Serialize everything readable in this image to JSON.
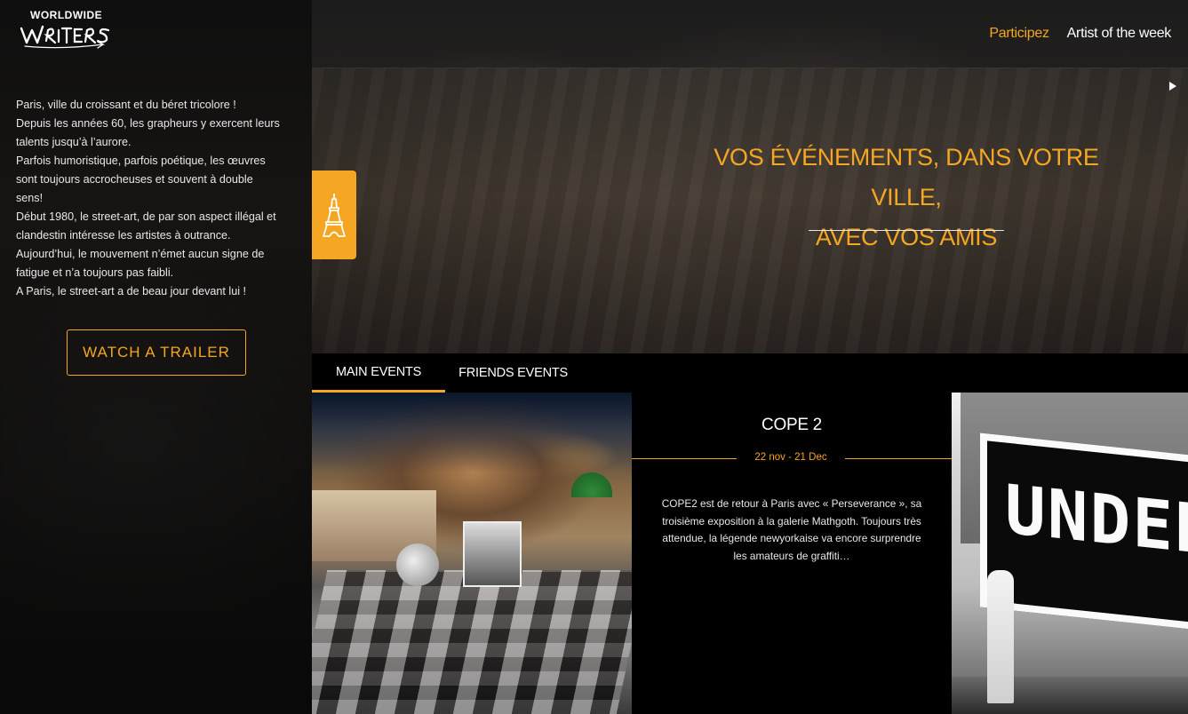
{
  "brand": {
    "top_text": "WORLDWIDE",
    "wordmark": "WRITERS"
  },
  "nav": {
    "items": [
      {
        "label": "Participez",
        "active": true
      },
      {
        "label": "Artist of the week",
        "active": false
      }
    ]
  },
  "intro": {
    "lines": [
      "Paris, ville du croissant et du béret tricolore !",
      "Depuis les années 60, les grapheurs y exercent leurs talents jusqu’à l’aurore.",
      "Parfois humoristique, parfois poétique, les œuvres sont toujours accrocheuses et souvent à double sens!",
      "Début 1980, le street-art, de par son aspect illégal et clandestin intéresse les artistes à outrance.",
      "Aujourd’hui, le mouvement n’émet aucun signe de fatigue et n’a toujours pas faibli.",
      "A Paris, le street-art a de beau jour devant lui !"
    ]
  },
  "trailer_button": "WATCH A TRAILER",
  "hero": {
    "tagline_line1": "VOS ÉVÉNEMENTS, DANS VOTRE VILLE,",
    "tagline_line2": "AVEC VOS AMIS",
    "city_icon": "eiffel-tower-icon",
    "next_icon": "play-arrow-icon"
  },
  "events": {
    "tabs": [
      {
        "label": "MAIN EVENTS",
        "active": true
      },
      {
        "label": "FRIENDS EVENTS",
        "active": false
      }
    ],
    "featured": {
      "title": "COPE 2",
      "date": "22 nov - 21 Dec",
      "description": "COPE2 est de retour à Paris avec « Perseverance », sa troisième exposition à la galerie Mathgoth. Toujours très attendue, la légende newyorkaise va encore surprendre les amateurs de graffiti…",
      "right_sign_text": "UNDER"
    }
  },
  "colors": {
    "accent": "#f5a623",
    "background": "#141414",
    "panel": "#000000"
  }
}
